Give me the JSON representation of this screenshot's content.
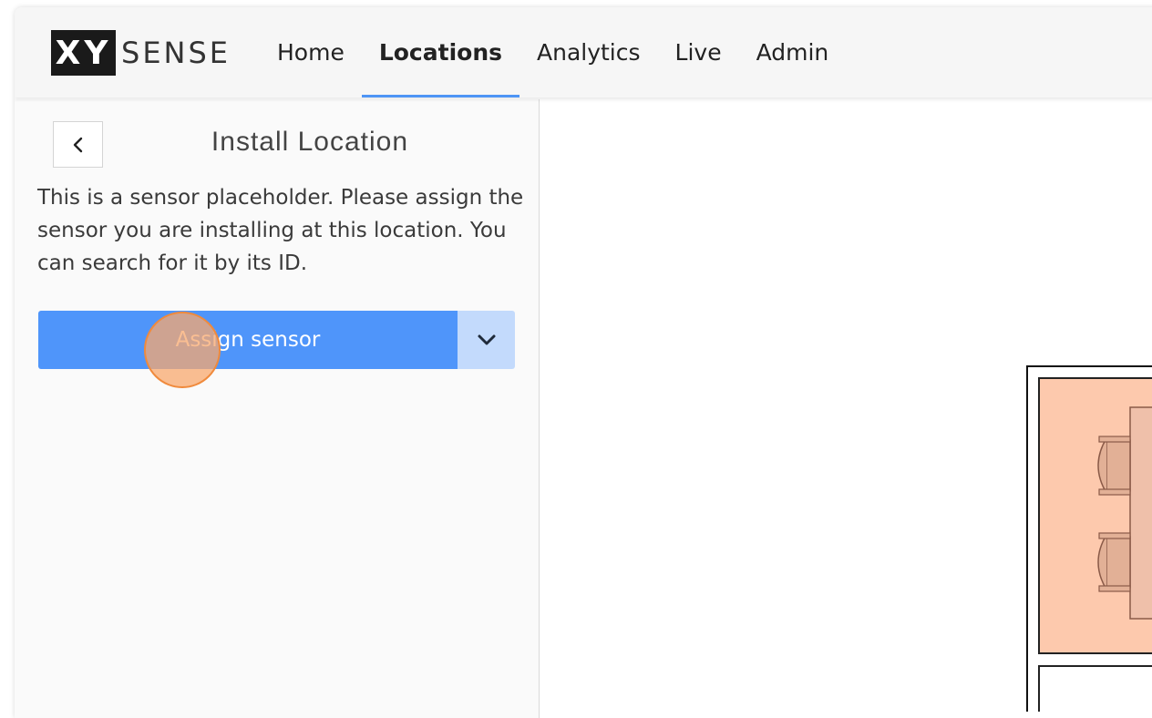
{
  "brand": {
    "logo_box": "XY",
    "logo_word": "SENSE"
  },
  "nav": {
    "items": [
      {
        "label": "Home",
        "active": false
      },
      {
        "label": "Locations",
        "active": true
      },
      {
        "label": "Analytics",
        "active": false
      },
      {
        "label": "Live",
        "active": false
      },
      {
        "label": "Admin",
        "active": false
      }
    ]
  },
  "panel": {
    "back_icon": "chevron-left-icon",
    "title": "Install Location",
    "description": "This is a sensor placeholder. Please assign the sensor you are installing at this location. You can search for it by its ID.",
    "assign_button": "Assign sensor",
    "dropdown_icon": "chevron-down-icon"
  },
  "colors": {
    "accent": "#4f95fa",
    "accent_light": "#c3dafc",
    "room_fill": "#fdc9ad",
    "furniture": "#e8b8a0"
  }
}
